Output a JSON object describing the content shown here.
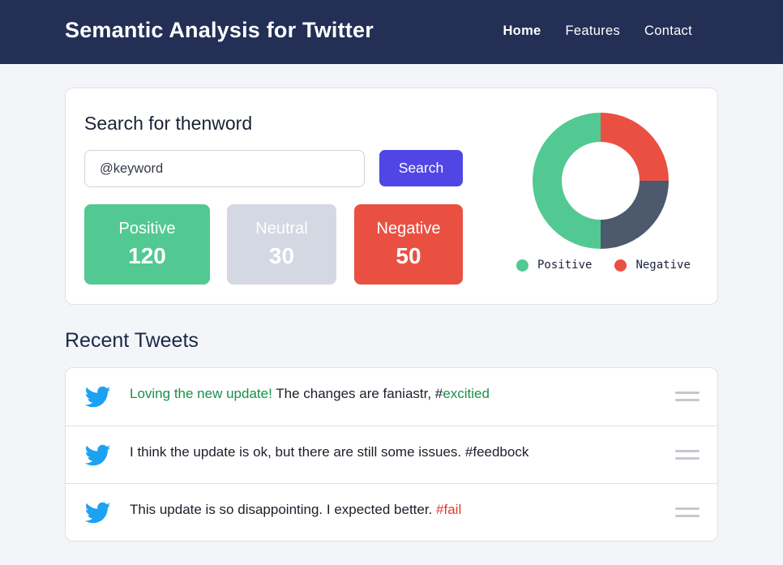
{
  "header": {
    "title": "Semantic Analysis for Twitter",
    "nav": [
      {
        "label": "Home",
        "active": true
      },
      {
        "label": "Features",
        "active": false
      },
      {
        "label": "Contact",
        "active": false
      }
    ]
  },
  "search": {
    "title": "Search for thenword",
    "input_value": "@keyword",
    "button_label": "Search"
  },
  "stats": {
    "positive": {
      "label": "Positive",
      "count": "120"
    },
    "neutral": {
      "label": "Neutral",
      "count": "30"
    },
    "negative": {
      "label": "Negative",
      "count": "50"
    }
  },
  "chart_data": {
    "type": "pie",
    "donut": true,
    "slices": [
      {
        "name": "Positive",
        "value": 50,
        "color": "#52c992"
      },
      {
        "name": "Negative",
        "value": 25,
        "color": "#ea5041"
      },
      {
        "value": 25,
        "color": "#4d596d"
      }
    ],
    "legend": [
      "Positive",
      "Negative"
    ],
    "legend_position": "bottom"
  },
  "recent": {
    "title": "Recent Tweets",
    "tweets": [
      {
        "icon": "twitter-bird-icon",
        "highlight": "Loving the new update!",
        "text": " The changes are faniastr, ",
        "hashtag_prefix": "#",
        "hashtag": "excitied"
      },
      {
        "icon": "twitter-bird-icon",
        "text": "I think the update is ok, but there are still some issues. ",
        "hashtag": "#feedbock"
      },
      {
        "icon": "twitter-bird-icon",
        "text": "This update is so disappointing. I expected better. ",
        "hashtag": "#fail"
      }
    ]
  },
  "colors": {
    "navbar": "#232f55",
    "accent": "#4f46e5",
    "positive": "#52c992",
    "neutral": "#d4d8e2",
    "negative": "#ea5041",
    "twitter": "#1da1f2"
  }
}
